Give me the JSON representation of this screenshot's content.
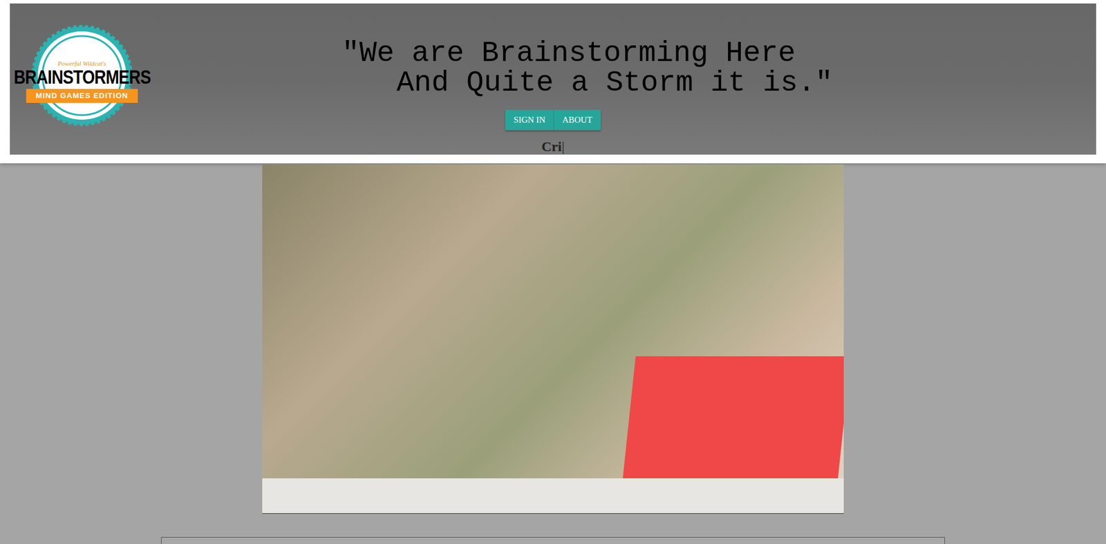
{
  "logo": {
    "tagline": "Powerful Wildcat's",
    "title": "BRAINSTORMERS",
    "subtitle": "MIND GAMES EDITION"
  },
  "quote": {
    "lines": [
      "\"We are Brainstorming Here",
      "And Quite a Storm it is.\""
    ]
  },
  "nav": [
    {
      "label": "SIGN IN"
    },
    {
      "label": "ABOUT"
    }
  ],
  "typing": {
    "text": "Cri",
    "cursor": "|"
  }
}
